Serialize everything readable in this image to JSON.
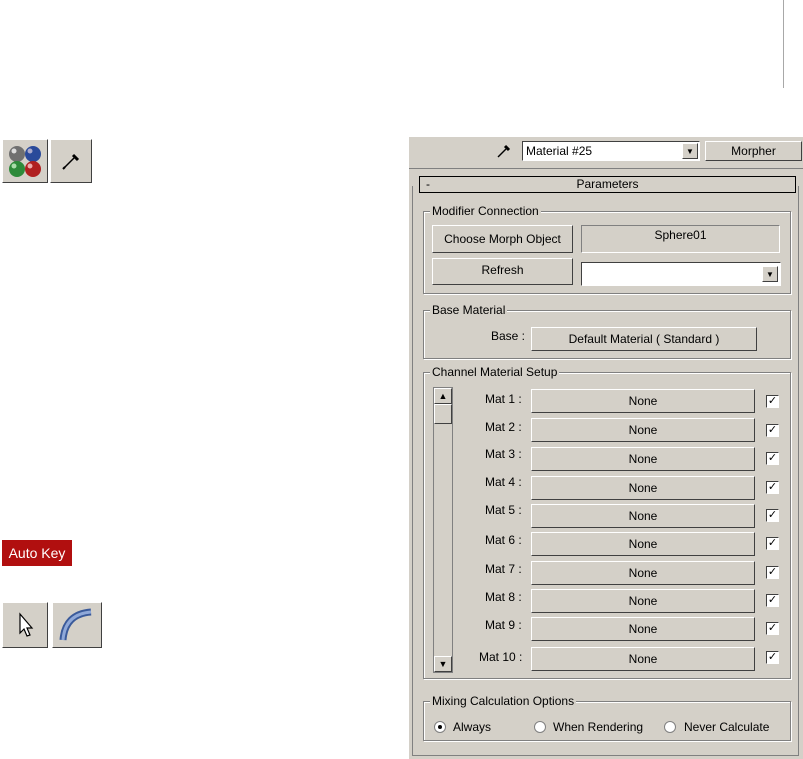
{
  "toolbar": {
    "material_icon": "material-spheres-icon",
    "pick_icon": "eyedropper-icon",
    "auto_key": "Auto Key",
    "select_icon": "arrow-cursor-icon",
    "arc_icon": "arc-rotate-icon"
  },
  "panel": {
    "material_name": "Material #25",
    "type_button": "Morpher",
    "rollout_toggle": "-",
    "rollout_title": "Parameters",
    "modifier_connection": {
      "title": "Modifier Connection",
      "choose_button": "Choose Morph Object",
      "object_name": "Sphere01",
      "refresh_button": "Refresh"
    },
    "base_material": {
      "title": "Base Material",
      "label": "Base :",
      "button": "Default Material  ( Standard )"
    },
    "channel_setup": {
      "title": "Channel Material Setup",
      "channels": [
        {
          "label": "Mat 1 :",
          "value": "None",
          "checked": "✓"
        },
        {
          "label": "Mat 2 :",
          "value": "None",
          "checked": "✓"
        },
        {
          "label": "Mat 3 :",
          "value": "None",
          "checked": "✓"
        },
        {
          "label": "Mat 4 :",
          "value": "None",
          "checked": "✓"
        },
        {
          "label": "Mat 5 :",
          "value": "None",
          "checked": "✓"
        },
        {
          "label": "Mat 6 :",
          "value": "None",
          "checked": "✓"
        },
        {
          "label": "Mat 7 :",
          "value": "None",
          "checked": "✓"
        },
        {
          "label": "Mat 8 :",
          "value": "None",
          "checked": "✓"
        },
        {
          "label": "Mat 9 :",
          "value": "None",
          "checked": "✓"
        },
        {
          "label": "Mat 10 :",
          "value": "None",
          "checked": "✓"
        }
      ]
    },
    "mixing": {
      "title": "Mixing Calculation Options",
      "always": "Always",
      "when_rendering": "When Rendering",
      "never": "Never Calculate",
      "selected": "Always"
    }
  }
}
